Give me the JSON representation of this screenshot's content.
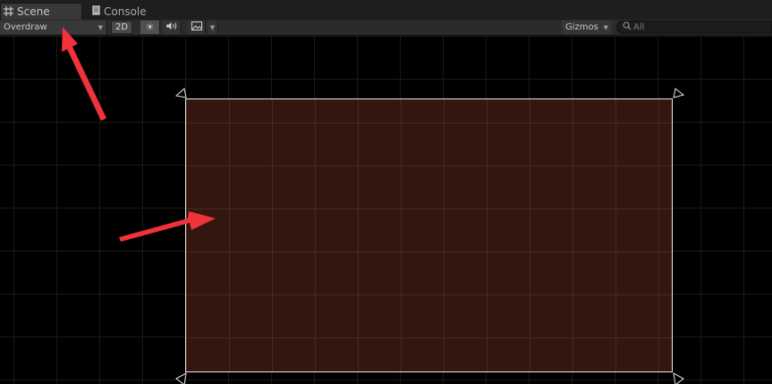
{
  "tabs": [
    {
      "label": "Scene",
      "icon": "scene-grid-icon",
      "active": true
    },
    {
      "label": "Console",
      "icon": "console-icon",
      "active": false
    }
  ],
  "toolbar": {
    "draw_mode": "Overdraw",
    "mode_2d_label": "2D",
    "lighting_icon": "sun-icon",
    "audio_icon": "speaker-icon",
    "effects_icon": "image-effects-icon",
    "gizmos_label": "Gizmos",
    "search_placeholder": "All"
  },
  "viewport": {
    "background_color": "#000000",
    "grid_color": "#1a1a1a",
    "canvas_fill_color": "#33160e",
    "canvas_border_color": "#e8e8e8"
  },
  "annotations": {
    "arrow_color": "#f0323a"
  }
}
